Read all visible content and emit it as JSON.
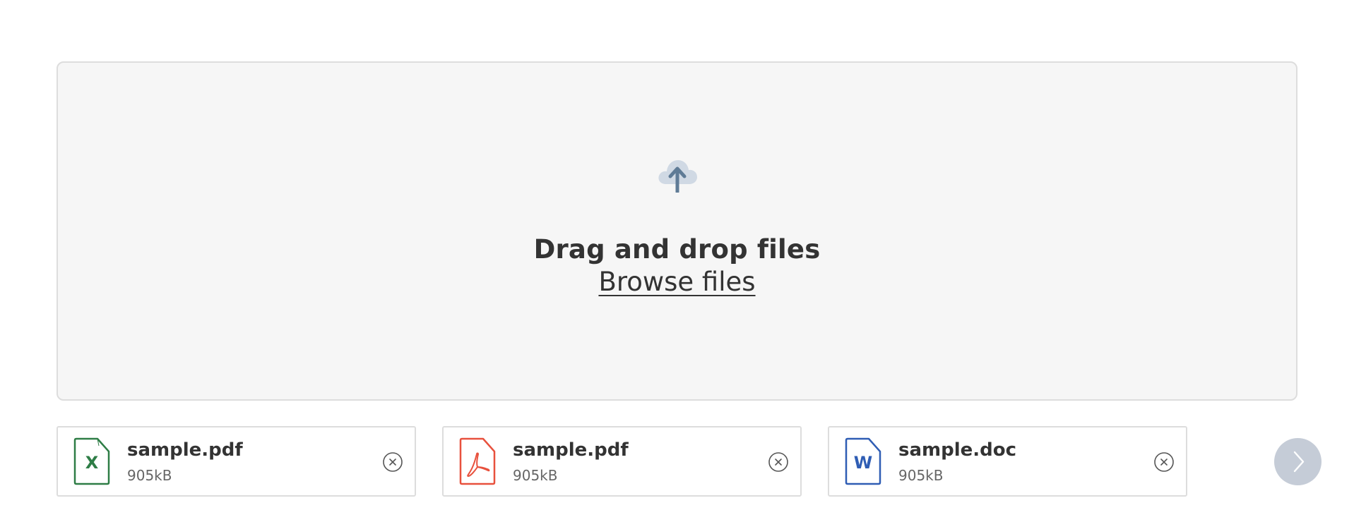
{
  "upload": {
    "icon": "cloud-upload-icon",
    "title": "Drag and drop files",
    "browse_label": "Browse files"
  },
  "files": [
    {
      "name": "sample.pdf",
      "size": "905kB",
      "icon": "excel-file-icon",
      "icon_letter": "X",
      "color": "#2e7d46"
    },
    {
      "name": "sample.pdf",
      "size": "905kB",
      "icon": "pdf-file-icon",
      "color": "#e8513d"
    },
    {
      "name": "sample.doc",
      "size": "905kB",
      "icon": "word-file-icon",
      "icon_letter": "W",
      "color": "#2f5db4"
    }
  ],
  "controls": {
    "remove_icon": "close-circle-icon",
    "next_icon": "chevron-right-icon"
  },
  "colors": {
    "dropzone_bg": "#f6f6f6",
    "border": "#dddddd",
    "upload_arrow": "#5f7b96",
    "upload_cloud": "#d0d9e4",
    "next_button": "#c5ccd7"
  }
}
